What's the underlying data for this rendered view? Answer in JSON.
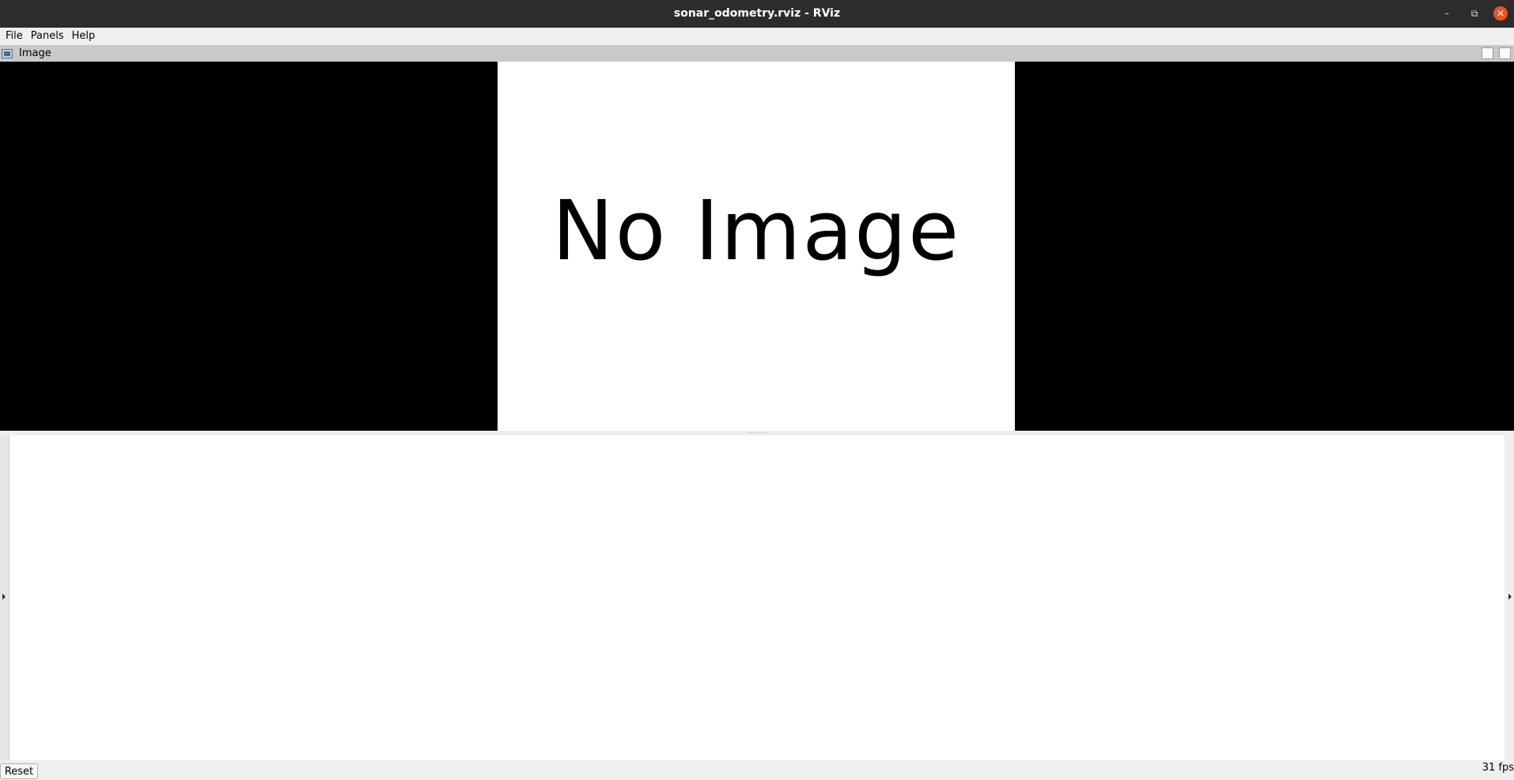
{
  "window": {
    "title": "sonar_odometry.rviz - RViz",
    "controls": {
      "minimize": "–",
      "maximize": "⧉",
      "close": "✕"
    }
  },
  "menu": [
    {
      "label": "File"
    },
    {
      "label": "Panels"
    },
    {
      "label": "Help"
    }
  ],
  "panel": {
    "title": "Image",
    "icon": "image-panel-icon",
    "placeholder_text": "No Image"
  },
  "footer": {
    "reset_label": "Reset",
    "fps": "31 fps"
  }
}
